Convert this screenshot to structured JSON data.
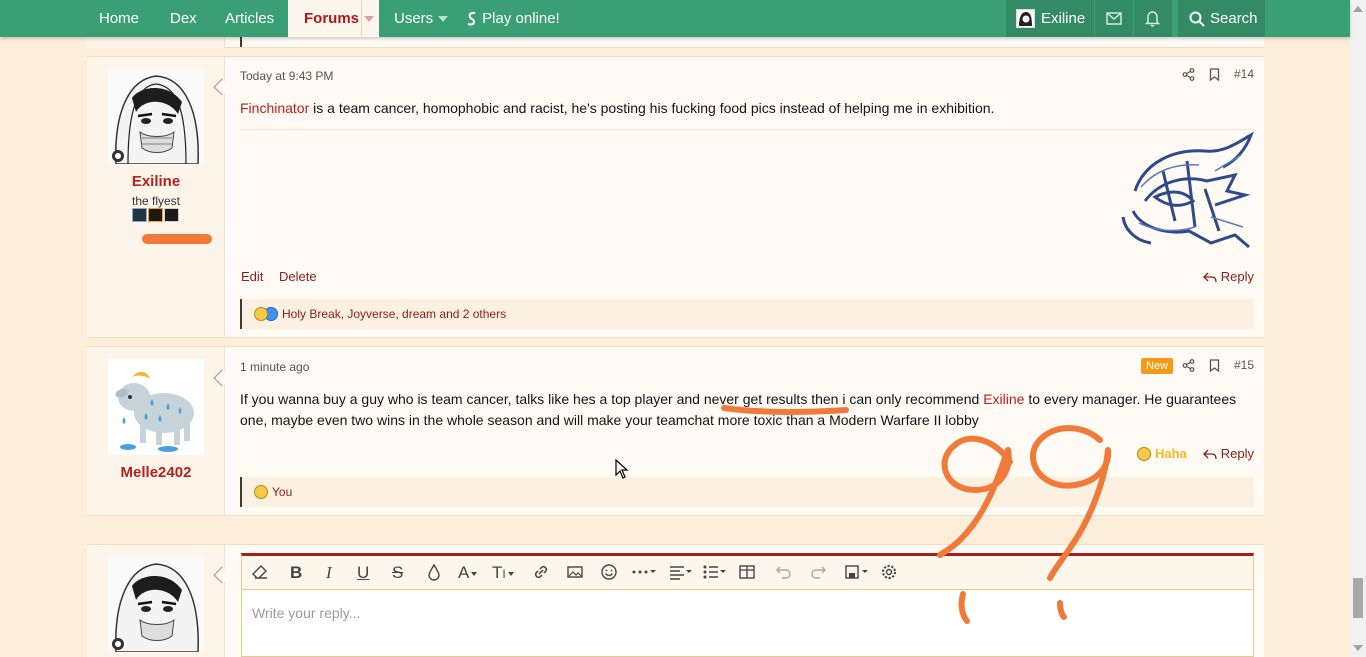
{
  "nav": {
    "items": [
      {
        "label": "Home"
      },
      {
        "label": "Dex"
      },
      {
        "label": "Articles"
      },
      {
        "label": "Forums"
      },
      {
        "label": "Users"
      },
      {
        "label": "Play online!"
      }
    ],
    "account_name": "Exiline",
    "search_label": "Search"
  },
  "posts": [
    {
      "username": "Exiline",
      "user_title": "the flyest",
      "time": "Today at 9:43 PM",
      "number": "#14",
      "message_link": "Finchinator",
      "message_rest": " is a team cancer, homophobic and racist, he's posting his fucking food pics instead of helping me in exhibition.",
      "edit_label": "Edit",
      "delete_label": "Delete",
      "reply_label": "Reply",
      "reactions_text": "Holy Break, Joyverse, dream and 2 others"
    },
    {
      "username": "Melle2402",
      "time": "1 minute ago",
      "badge": "New",
      "number": "#15",
      "message_a": "If you wanna buy a guy who is team cancer, talks like hes a top player and never get results then i can only recommend ",
      "message_link": "Exiline",
      "message_b": " to every manager. He guarantees one, maybe even two wins in the whole season and will make your teamchat more toxic than a Modern Warfare II lobby",
      "haha_label": "Haha",
      "reply_label": "Reply",
      "reactions_text": "You"
    }
  ],
  "editor": {
    "placeholder": "Write your reply..."
  },
  "colors": {
    "nav_green": "#3a9f74",
    "accent_red": "#b52121",
    "doodle_orange": "#f07a3a"
  }
}
